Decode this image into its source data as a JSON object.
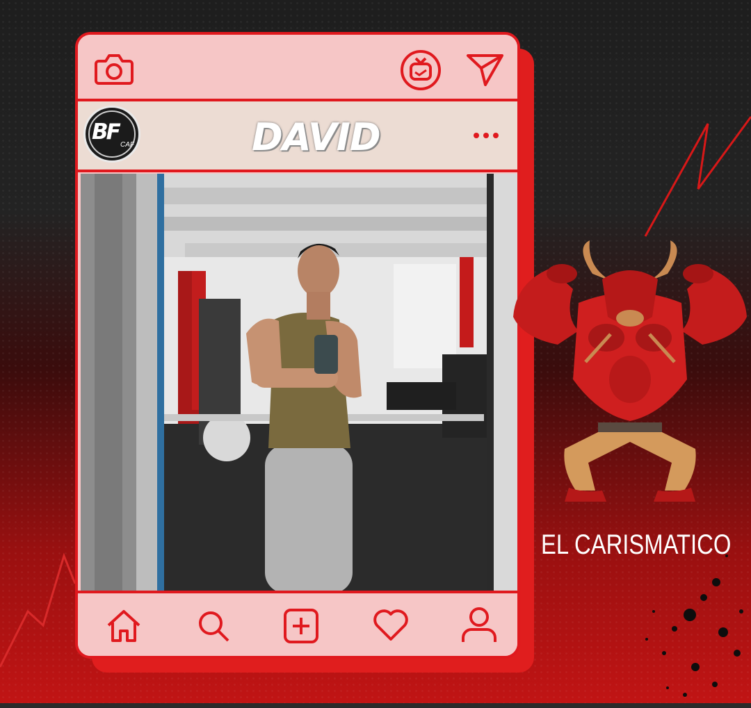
{
  "post": {
    "username": "DAVID",
    "avatar_logo": "BF",
    "avatar_sub": "CAF"
  },
  "caption": {
    "text": "EL CARISMATICO"
  },
  "icons": {
    "top_left": "camera-icon",
    "top_right_1": "tv-icon",
    "top_right_2": "send-icon",
    "more": "more-dots-icon",
    "nav": [
      "home-icon",
      "search-icon",
      "add-post-icon",
      "heart-icon",
      "profile-icon"
    ]
  },
  "colors": {
    "accent": "#e0191e",
    "card_fill": "#f6c6c6",
    "userbar_fill": "#ecdcd3"
  }
}
